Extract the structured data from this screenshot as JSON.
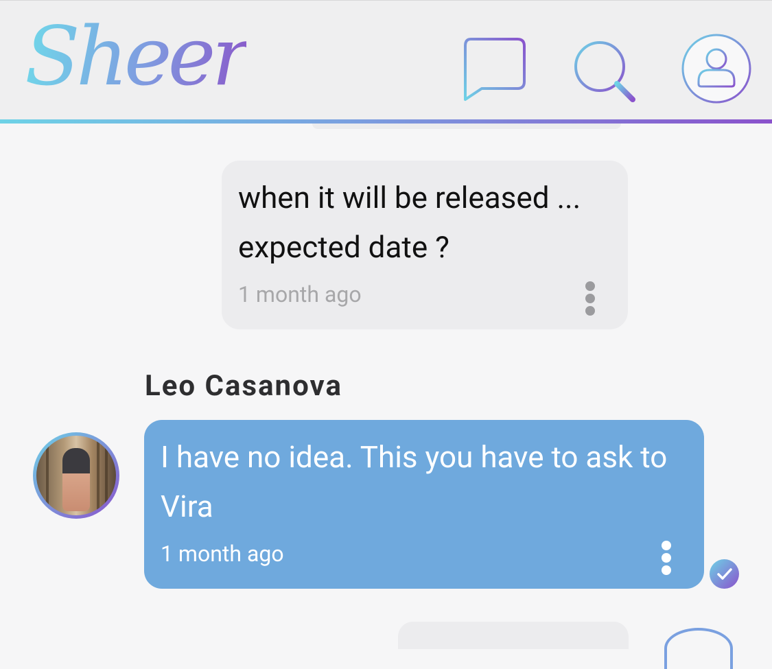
{
  "header": {
    "logo_text": "Sheer",
    "icons": [
      "chat-menu-icon",
      "search-icon",
      "profile-icon"
    ]
  },
  "messages": [
    {
      "direction": "outgoing",
      "text": "when it will be released ... expected date ?",
      "time": "1 month ago"
    },
    {
      "direction": "incoming",
      "sender": "Leo Casanova",
      "text": "I have no idea. This you have to ask to Vira",
      "time": "1 month ago",
      "read": true
    }
  ],
  "colors": {
    "accent_start": "#6ed2e6",
    "accent_end": "#8a52cc",
    "incoming_bubble": "#6fa9dd",
    "outgoing_bubble": "#ececee"
  }
}
